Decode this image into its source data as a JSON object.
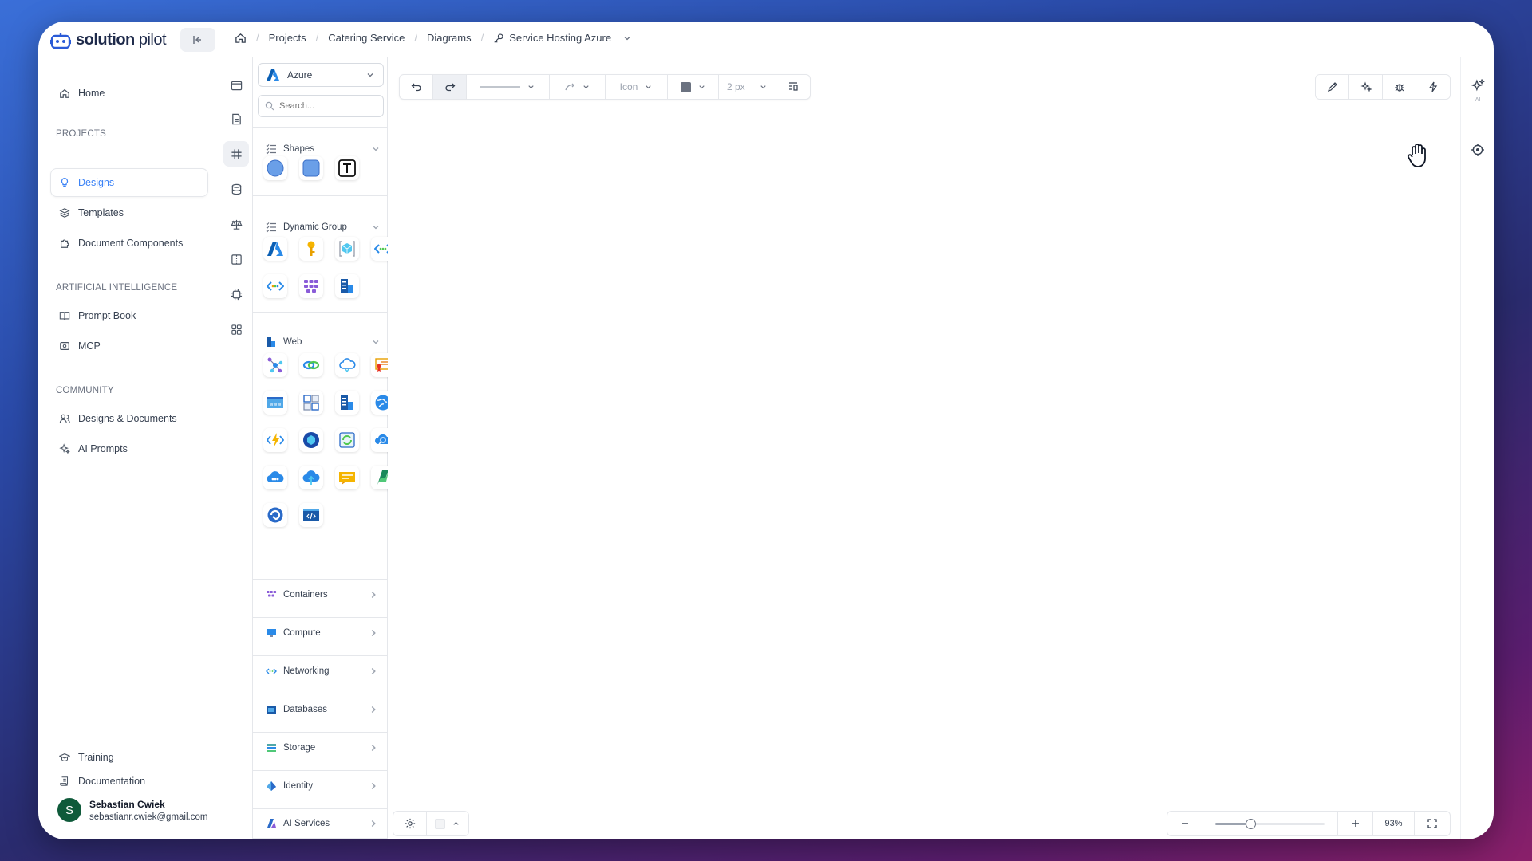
{
  "app": {
    "logo_bold": "solution",
    "logo_light": " pilot"
  },
  "breadcrumbs": [
    "Projects",
    "Catering Service",
    "Diagrams"
  ],
  "current_diagram": "Service Hosting Azure",
  "sidebar": {
    "home": "Home",
    "projects_title": "PROJECTS",
    "projects": [
      "Designs",
      "Templates",
      "Document Components"
    ],
    "ai_title": "ARTIFICIAL INTELLIGENCE",
    "ai_items": [
      "Prompt Book",
      "MCP"
    ],
    "community_title": "COMMUNITY",
    "community_items": [
      "Designs & Documents",
      "AI Prompts"
    ],
    "footer_items": [
      "Training",
      "Documentation"
    ]
  },
  "user": {
    "initial": "S",
    "name": "Sebastian Cwiek",
    "email": "sebastianr.cwiek@gmail.com"
  },
  "panel": {
    "provider": "Azure",
    "search_placeholder": "Search...",
    "groups": [
      "Shapes",
      "Dynamic Group",
      "Web"
    ],
    "categories": [
      "Containers",
      "Compute",
      "Networking",
      "Databases",
      "Storage",
      "Identity",
      "AI Services"
    ]
  },
  "toolbar": {
    "icon_label": "Icon",
    "stroke_width": "2 px"
  },
  "zoom": {
    "level_label": "93%",
    "slider_fraction": 0.32
  },
  "right_rail": {
    "ai_caption": "AI"
  },
  "colors": {
    "accent": "#3b82f6",
    "azure": "#0078d4",
    "avatar": "#0f5a3a"
  }
}
